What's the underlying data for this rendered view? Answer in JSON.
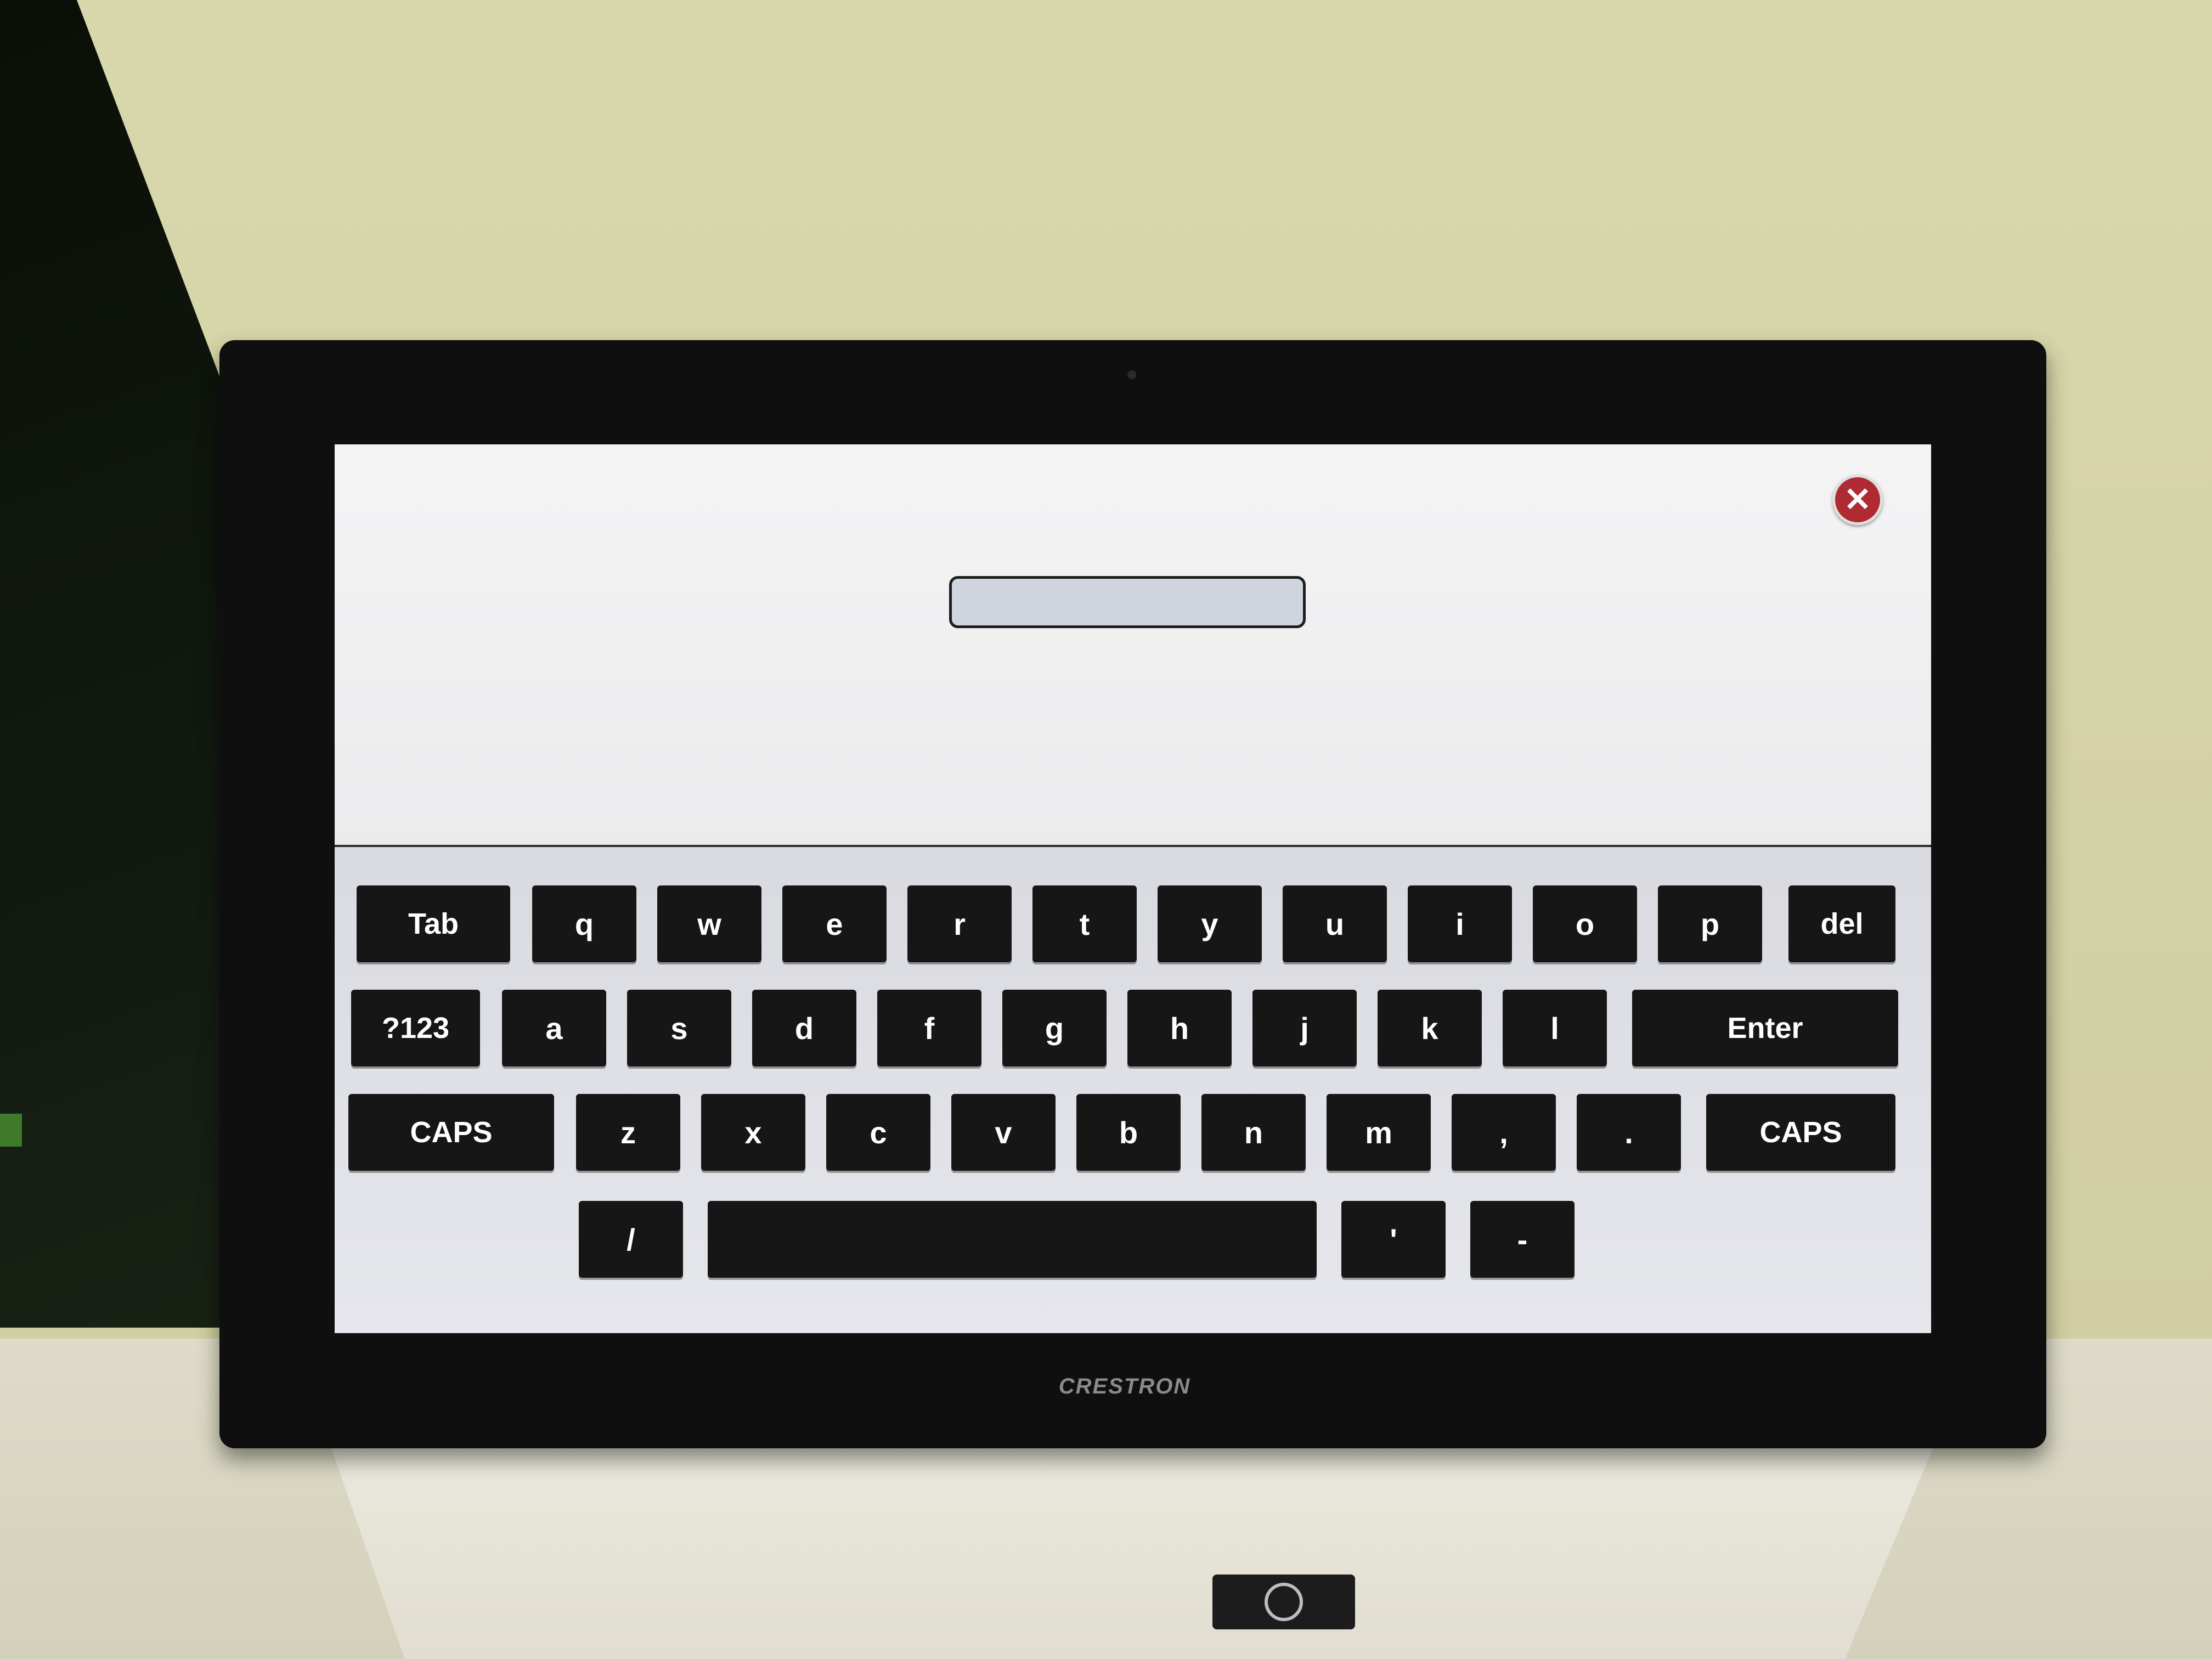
{
  "device": {
    "brand": "CRESTRON"
  },
  "dialog": {
    "text_field": {
      "value": "",
      "placeholder": ""
    },
    "close_icon": "close-x-icon",
    "close_color": "#b02a33"
  },
  "keyboard": {
    "key_color": "#161616",
    "label_color": "#ffffff",
    "row1": [
      "Tab",
      "q",
      "w",
      "e",
      "r",
      "t",
      "y",
      "u",
      "i",
      "o",
      "p",
      "del"
    ],
    "row2": [
      "?123",
      "a",
      "s",
      "d",
      "f",
      "g",
      "h",
      "j",
      "k",
      "l",
      "Enter"
    ],
    "row3": [
      "CAPS",
      "z",
      "x",
      "c",
      "v",
      "b",
      "n",
      "m",
      ",",
      ".",
      "CAPS"
    ],
    "row4": [
      "/",
      "",
      "'",
      "-"
    ]
  }
}
